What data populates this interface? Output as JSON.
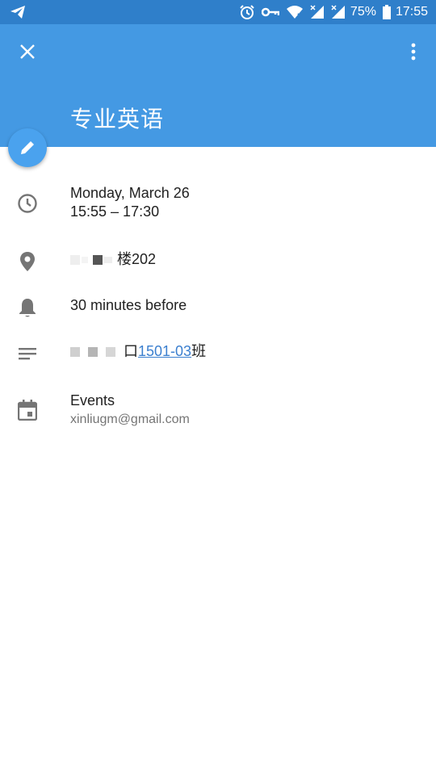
{
  "status_bar": {
    "battery": "75%",
    "time": "17:55",
    "icons": [
      "telegram-icon",
      "alarm-icon",
      "vpn-key-icon",
      "wifi-icon",
      "signal-icon",
      "signal-icon",
      "battery-icon"
    ]
  },
  "header": {
    "title": "专业英语",
    "close_icon": "close-icon",
    "more_icon": "more-vert-icon"
  },
  "fab": {
    "icon": "edit-pencil-icon"
  },
  "details": {
    "date": "Monday, March 26",
    "time": "15:55 – 17:30",
    "location_suffix": "楼202",
    "reminder": "30 minutes before",
    "description_prefix": "口",
    "description_link": "1501-03",
    "description_suffix": "班",
    "calendar_name": "Events",
    "calendar_account": "xinliugm@gmail.com"
  },
  "colors": {
    "status_bar": "#2f7fca",
    "header": "#4499e3",
    "fab": "#4aa2ee",
    "link": "#3b7fcf",
    "icon_gray": "#757575"
  }
}
